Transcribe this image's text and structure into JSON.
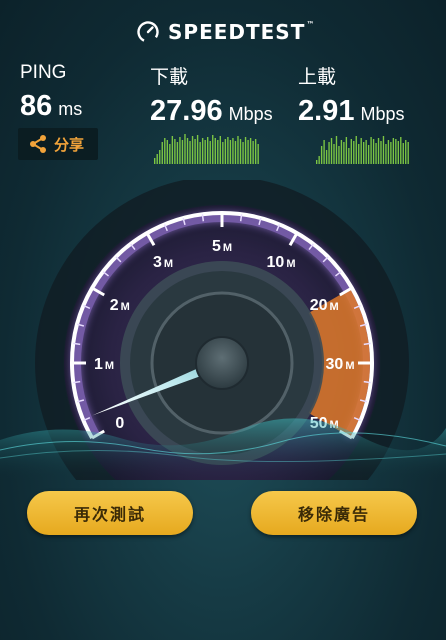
{
  "app": {
    "logo_text": "SPEEDTEST",
    "trademark": "™"
  },
  "metrics": {
    "ping": {
      "label": "PING",
      "value": "86",
      "unit": "ms"
    },
    "download": {
      "label": "下載",
      "value": "27.96",
      "unit": "Mbps"
    },
    "upload": {
      "label": "上載",
      "value": "2.91",
      "unit": "Mbps"
    }
  },
  "share": {
    "label": "分享",
    "icon": "share-icon"
  },
  "gauge": {
    "ticks": [
      {
        "num": "0",
        "unit": ""
      },
      {
        "num": "1",
        "unit": "M"
      },
      {
        "num": "2",
        "unit": "M"
      },
      {
        "num": "3",
        "unit": "M"
      },
      {
        "num": "5",
        "unit": "M"
      },
      {
        "num": "10",
        "unit": "M"
      },
      {
        "num": "20",
        "unit": "M"
      },
      {
        "num": "30",
        "unit": "M"
      },
      {
        "num": "50",
        "unit": "M"
      }
    ],
    "needle_value": "0"
  },
  "buttons": {
    "retest": "再次測試",
    "remove_ads": "移除廣告"
  },
  "colors": {
    "accent": "#f2a33a",
    "spark_green": "#7cc644",
    "gauge_orange": "#e07a2a",
    "button_gold": "#f0b830"
  }
}
